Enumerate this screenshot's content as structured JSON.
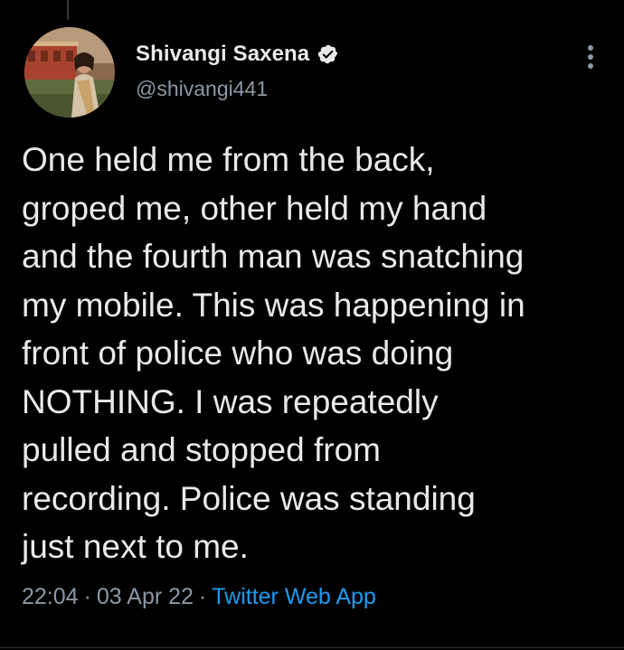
{
  "tweet": {
    "author": {
      "display_name": "Shivangi Saxena",
      "handle": "@shivangi441",
      "verified": true
    },
    "text": "One held me from the back,\ngroped me, other held my hand\nand the fourth man was snatching\nmy mobile. This was happening in\nfront of police who was doing\nNOTHING. I was repeatedly\npulled and stopped from\nrecording. Police was standing\njust next to me.",
    "meta": {
      "time": "22:04",
      "separator": "·",
      "date": "03 Apr 22",
      "source": "Twitter Web App"
    }
  },
  "icons": {
    "verified": "verified-badge-icon",
    "more": "more-vertical-icon"
  },
  "colors": {
    "background": "#000000",
    "primary_text": "#e7e9ea",
    "secondary_text": "#8b98a5",
    "link": "#1d9bf0"
  }
}
